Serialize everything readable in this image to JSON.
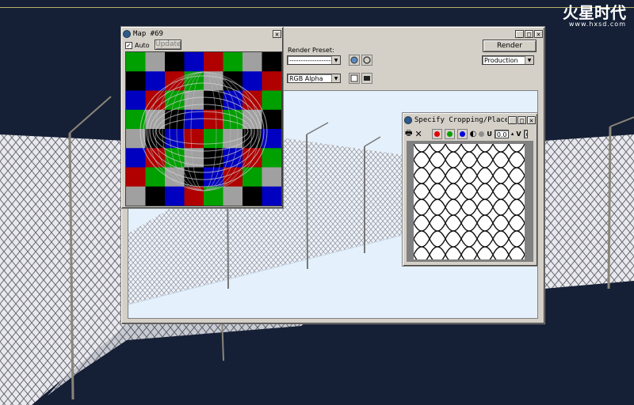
{
  "brand": {
    "logo_text": "火星时代",
    "url": "www.hxsd.com",
    "top_line_color": "#b8b06a"
  },
  "scene": {
    "background_color": "#152036",
    "subject": "chain-link fence"
  },
  "render_window": {
    "render_preset_label": "Render Preset:",
    "render_preset_value": "--------------------",
    "render_button": "Render",
    "production_value": "Production",
    "channel_value": "RGB Alpha",
    "title_buttons": [
      "_",
      "□",
      "×"
    ],
    "render_background": "#e4f0fb"
  },
  "map_window": {
    "title": "Map #69",
    "auto_label": "Auto",
    "auto_checked": true,
    "update_button": "Update",
    "title_buttons": [
      "×"
    ],
    "checker_colors": [
      "#00a000",
      "#0000c0",
      "#a0a0a0",
      "#b00000",
      "#000000"
    ]
  },
  "crop_window": {
    "title": "Specify Cropping/Placem",
    "title_buttons": [
      "_",
      "□",
      "×"
    ],
    "u_label": "U",
    "u_value": "0.0",
    "v_label": "V",
    "v_value": "0",
    "channel_colors": [
      "#e00000",
      "#00a000",
      "#0000e0"
    ]
  }
}
